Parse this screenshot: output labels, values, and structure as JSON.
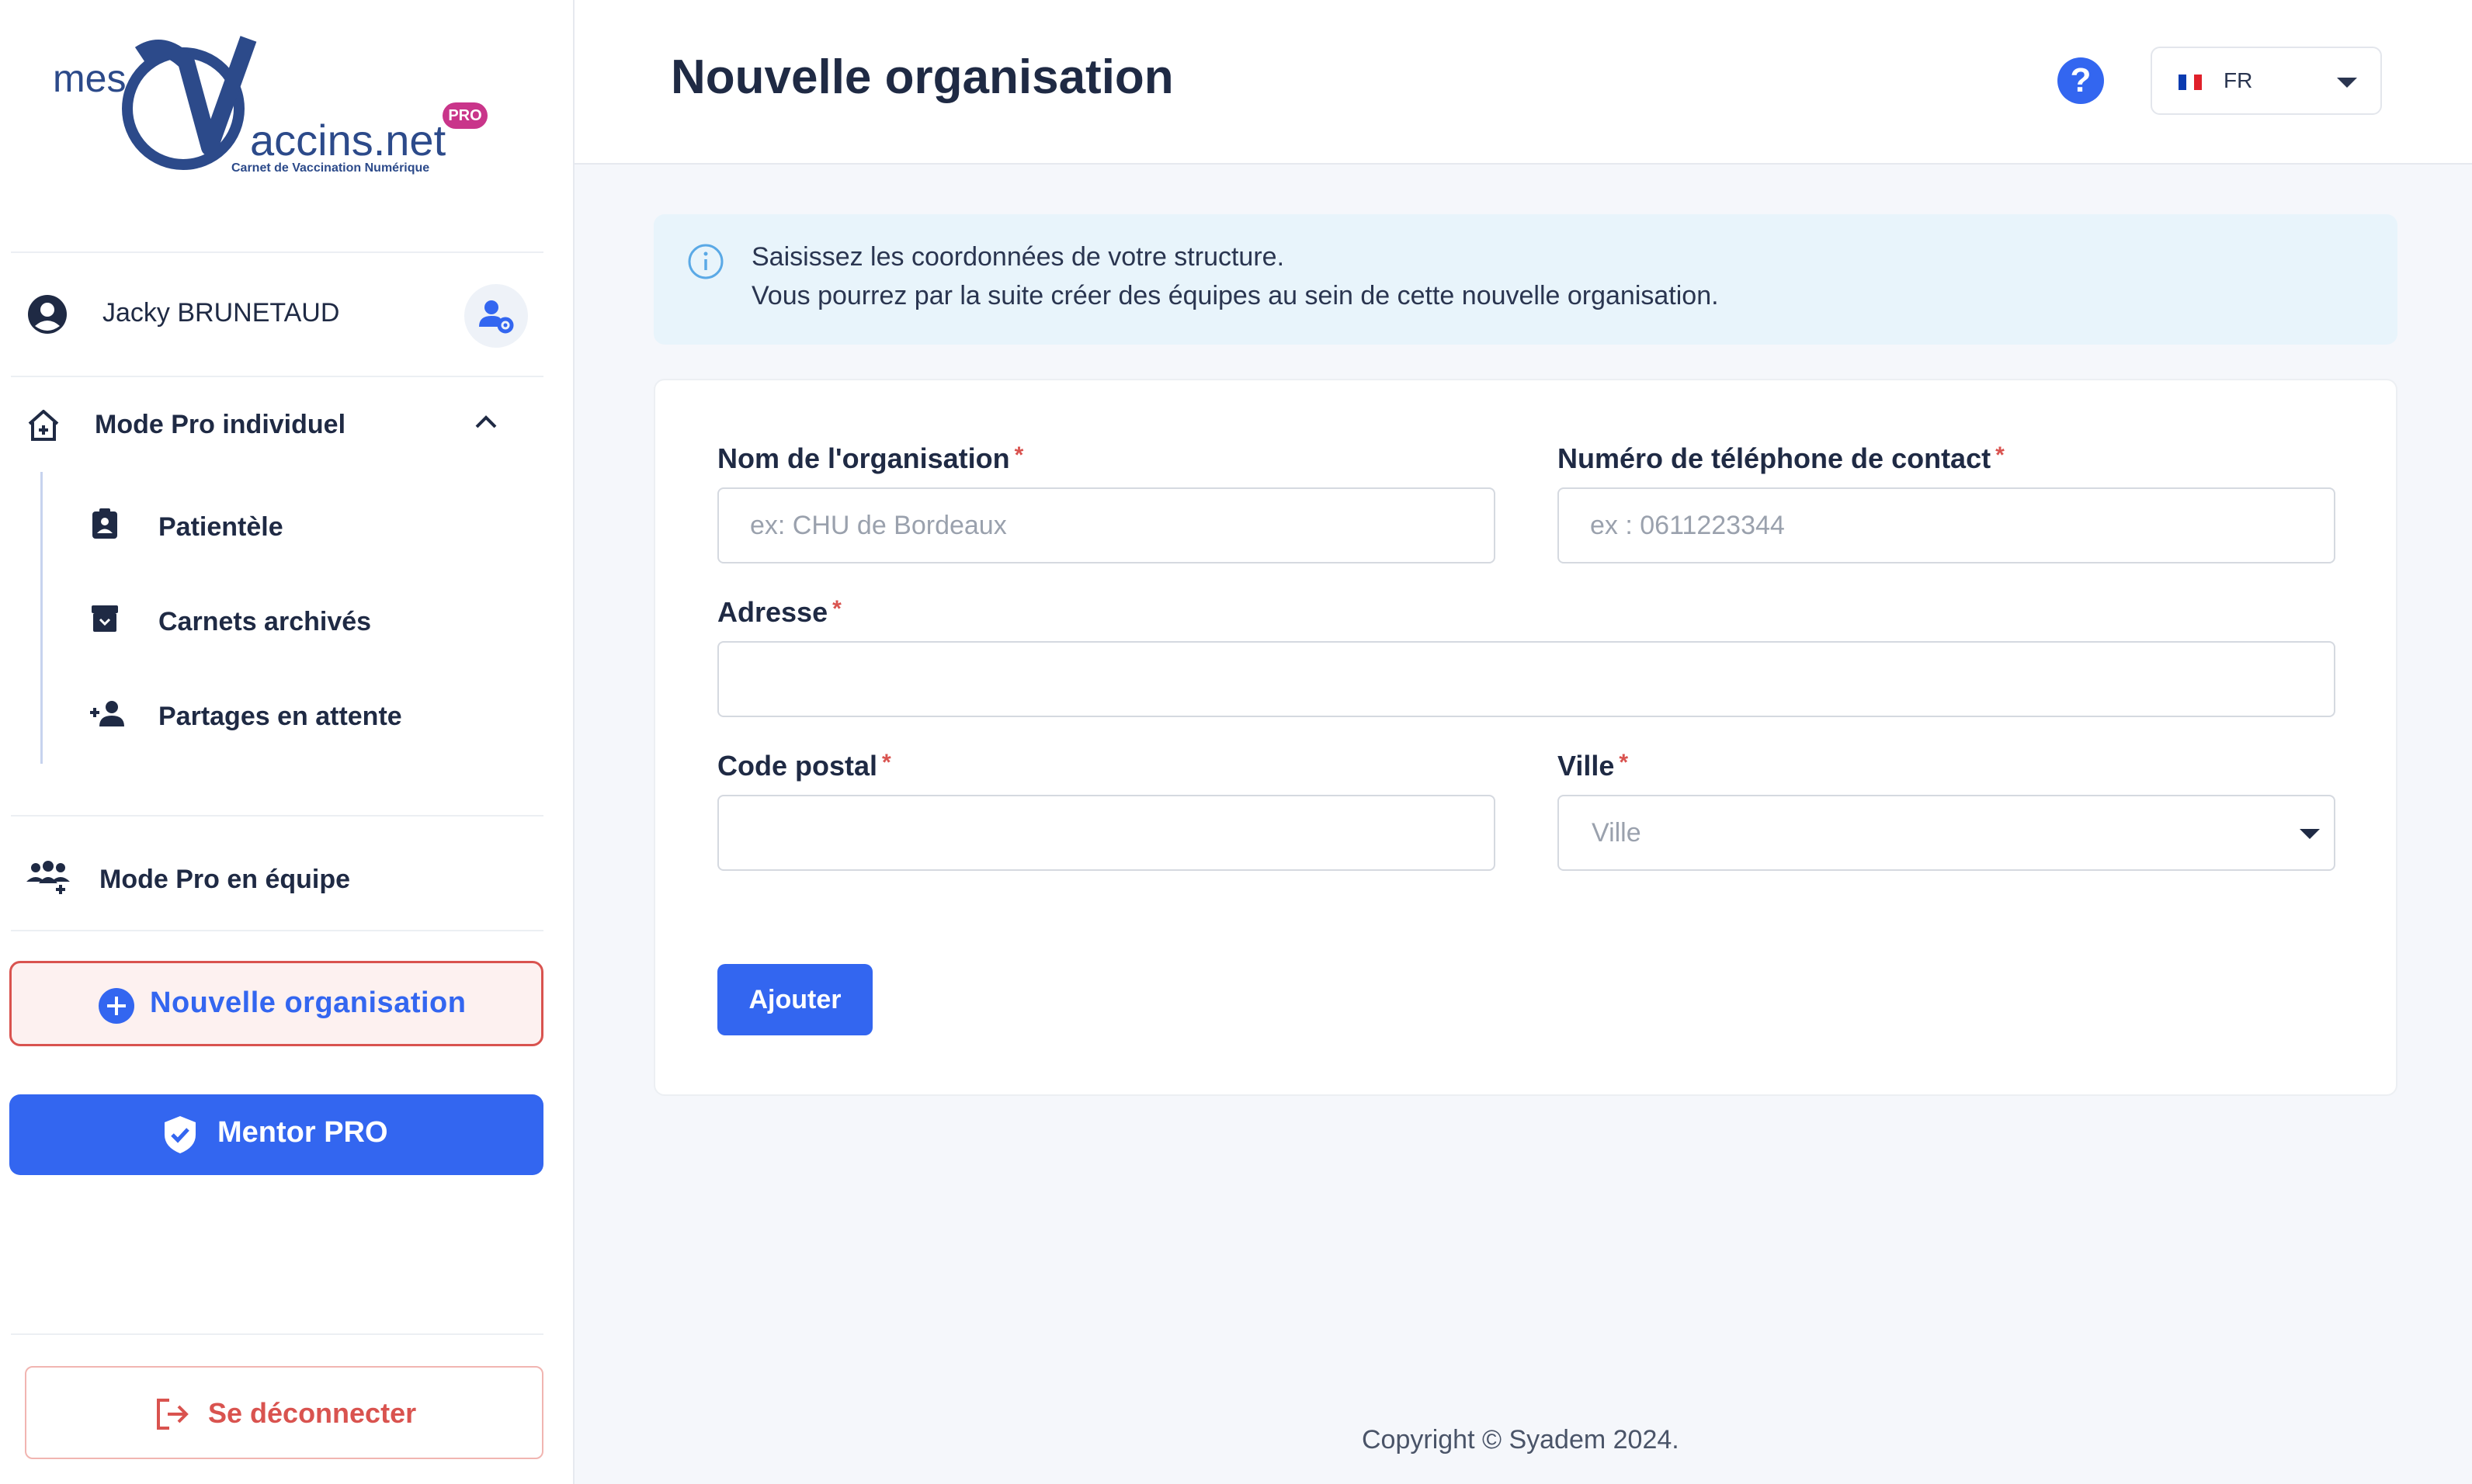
{
  "brand": {
    "logo_prefix": "mes",
    "logo_main": "accins.net",
    "logo_tagline": "Carnet de Vaccination Numérique",
    "logo_badge": "PRO"
  },
  "header": {
    "title": "Nouvelle organisation",
    "help_label": "?",
    "language": "FR"
  },
  "sidebar": {
    "user_name": "Jacky BRUNETAUD",
    "group_label": "Mode Pro individuel",
    "items": [
      {
        "label": "Patientèle",
        "icon": "clipboard-user-icon"
      },
      {
        "label": "Carnets archivés",
        "icon": "archive-box-icon"
      },
      {
        "label": "Partages en attente",
        "icon": "user-plus-icon"
      }
    ],
    "team_label": "Mode Pro en équipe",
    "new_org_label": "Nouvelle organisation",
    "mentor_label": "Mentor PRO",
    "logout_label": "Se déconnecter"
  },
  "info": {
    "line1": "Saisissez les coordonnées de votre structure.",
    "line2": "Vous pourrez par la suite créer des équipes au sein de cette nouvelle organisation."
  },
  "form": {
    "org_name_label": "Nom de l'organisation",
    "org_name_placeholder": "ex: CHU de Bordeaux",
    "phone_label": "Numéro de téléphone de contact",
    "phone_placeholder": "ex : 0611223344",
    "address_label": "Adresse",
    "postal_label": "Code postal",
    "city_label": "Ville",
    "city_placeholder": "Ville",
    "required_mark": "*",
    "submit_label": "Ajouter"
  },
  "footer": {
    "copyright": "Copyright © Syadem 2024."
  },
  "colors": {
    "primary": "#3366f0",
    "danger": "#d9534f",
    "text": "#1f2a44",
    "info_bg": "#e8f4fb"
  }
}
